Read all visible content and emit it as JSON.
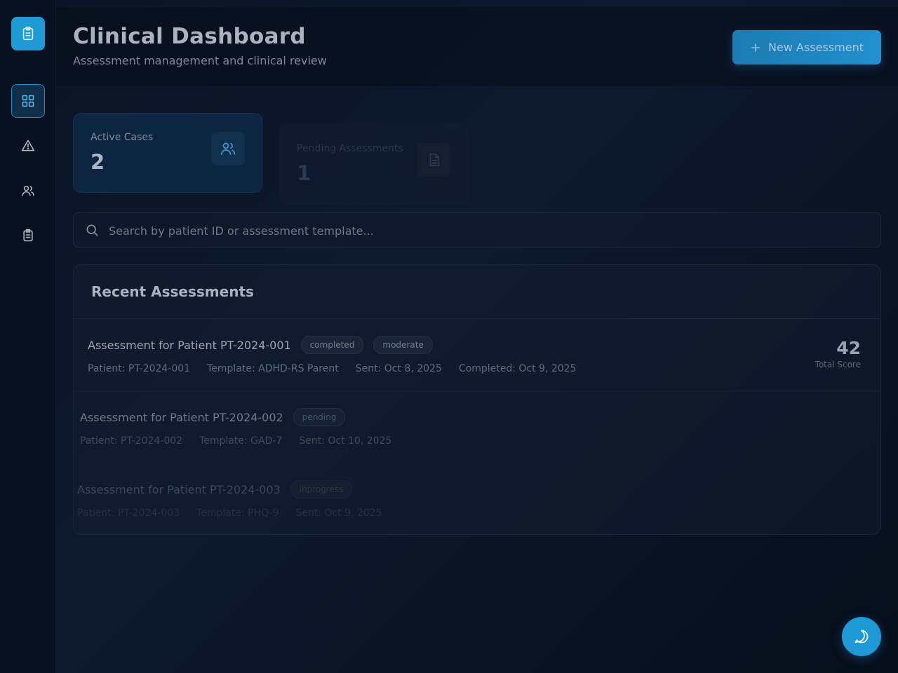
{
  "header": {
    "title": "Clinical Dashboard",
    "subtitle": "Assessment management and clinical review",
    "new_button_label": "New Assessment"
  },
  "sidebar": {
    "items": [
      {
        "name": "dashboard",
        "icon": "grid-icon",
        "active": true
      },
      {
        "name": "alerts",
        "icon": "alert-triangle-icon",
        "active": false
      },
      {
        "name": "patients",
        "icon": "users-icon",
        "active": false
      },
      {
        "name": "assessments",
        "icon": "clipboard-icon",
        "active": false
      }
    ]
  },
  "stats": [
    {
      "label": "Active Cases",
      "value": "2",
      "icon": "users-icon"
    },
    {
      "label": "Pending Assessments",
      "value": "1",
      "icon": "document-icon"
    }
  ],
  "search": {
    "placeholder": "Search by patient ID or assessment template..."
  },
  "assessments": {
    "title": "Recent Assessments",
    "rows": [
      {
        "title": "Assessment for Patient PT-2024-001",
        "status": "completed",
        "severity": "moderate",
        "patient": "Patient: PT-2024-001",
        "template": "Template: ADHD-RS Parent",
        "sent": "Sent: Oct 8, 2025",
        "completed": "Completed: Oct 9, 2025",
        "score": "42",
        "score_label": "Total Score"
      },
      {
        "title": "Assessment for Patient PT-2024-002",
        "status": "pending",
        "patient": "Patient: PT-2024-002",
        "template": "Template: GAD-7",
        "sent": "Sent: Oct 10, 2025"
      },
      {
        "title": "Assessment for Patient PT-2024-003",
        "status": "inprogress",
        "patient": "Patient: PT-2024-003",
        "template": "Template: PHQ-9",
        "sent": "Sent: Oct 9, 2025"
      }
    ]
  },
  "colors": {
    "accent": "#1e9ad6",
    "background": "#0b1424",
    "card_active": "#0d2540"
  }
}
